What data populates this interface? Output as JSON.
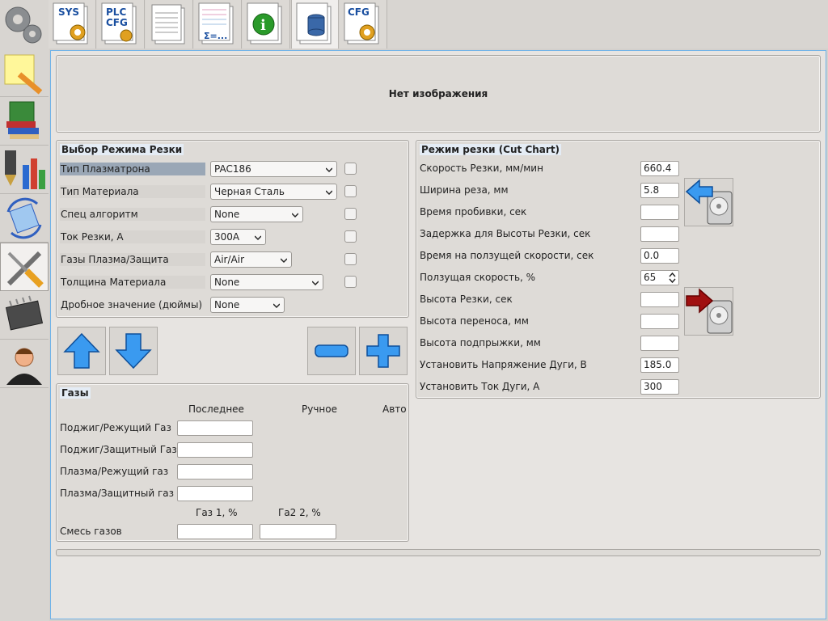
{
  "toolbar": {
    "tabs": [
      {
        "name": "sys",
        "label": "SYS"
      },
      {
        "name": "plc-cfg",
        "label_top": "PLC",
        "label_bottom": "CFG"
      },
      {
        "name": "document",
        "label": ""
      },
      {
        "name": "formula",
        "label": "Σ=..."
      },
      {
        "name": "info",
        "label": "i"
      },
      {
        "name": "database",
        "label": ""
      },
      {
        "name": "cfg",
        "label": "CFG"
      }
    ]
  },
  "sidebar": {
    "items": [
      "note-pencil-icon",
      "books-icon",
      "tools-chart-icon",
      "mycnc-icon",
      "wrench-screwdriver-icon",
      "chip-icon",
      "user-icon"
    ]
  },
  "image_panel": {
    "text": "Нет изображения"
  },
  "mode_panel": {
    "title": "Выбор Режима Резки",
    "rows": [
      {
        "label": "Тип Плазматрона",
        "value": "PAC186"
      },
      {
        "label": "Тип Материала",
        "value": "Черная Сталь"
      },
      {
        "label": "Спец алгоритм",
        "value": "None"
      },
      {
        "label": "Ток Резки, А",
        "value": "300A"
      },
      {
        "label": "Газы Плазма/Защита",
        "value": "Air/Air"
      },
      {
        "label": "Толщина Материала",
        "value": "None"
      },
      {
        "label": "Дробное значение (дюймы)",
        "value": "None"
      }
    ]
  },
  "gases": {
    "title": "Газы",
    "col_last": "Последнее",
    "col_manual": "Ручное",
    "col_auto": "Авто",
    "rows": [
      "Поджиг/Режущий Газ",
      "Поджиг/Защитный Газ",
      "Плазма/Режущий газ",
      "Плазма/Защитный газ"
    ],
    "gas1": "Газ 1, %",
    "gas2": "Га2 2, %",
    "mix": "Смесь газов"
  },
  "cut_chart": {
    "title": "Режим резки (Cut Chart)",
    "rows": [
      {
        "label": "Скорость Резки, мм/мин",
        "value": "660.4"
      },
      {
        "label": "Ширина реза, мм",
        "value": "5.8"
      },
      {
        "label": "Время пробивки, сек",
        "value": ""
      },
      {
        "label": "Задержка для Высоты Резки, сек",
        "value": ""
      },
      {
        "label": "Время на ползущей скорости, сек",
        "value": "0.0"
      },
      {
        "label": "Ползущая скорость, %",
        "value": "65"
      },
      {
        "label": "Высота Резки, сек",
        "value": ""
      },
      {
        "label": "Высота переноса, мм",
        "value": ""
      },
      {
        "label": "Высота подпрыжки, мм",
        "value": ""
      },
      {
        "label": "Установить Напряжение Дуги, В",
        "value": "185.0"
      },
      {
        "label": "Установить Ток Дуги, А",
        "value": "300"
      }
    ]
  },
  "colors": {
    "accent_blue": "#2e8ee6",
    "arrow_red": "#a01010",
    "selected_label": "#9aa7b6"
  }
}
